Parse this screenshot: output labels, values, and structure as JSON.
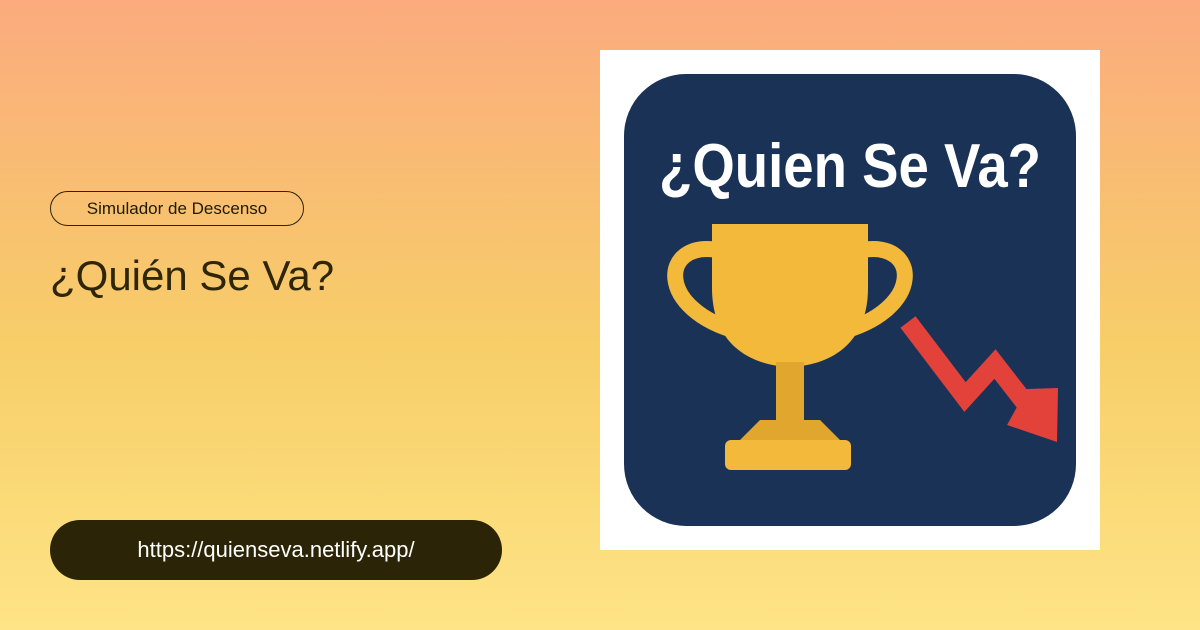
{
  "tag": "Simulador de Descenso",
  "title": "¿Quién Se Va?",
  "url": "https://quienseva.netlify.app/",
  "logo": {
    "text": "¿Quien Se Va?",
    "icons": [
      "trophy-icon",
      "trend-down-arrow-icon"
    ]
  },
  "colors": {
    "background_top": "#fbab7e",
    "background_bottom": "#fee486",
    "pill_bg": "#2b2406",
    "logo_bg": "#1b3257",
    "trophy": "#f2b93b",
    "arrow": "#e2423a"
  }
}
